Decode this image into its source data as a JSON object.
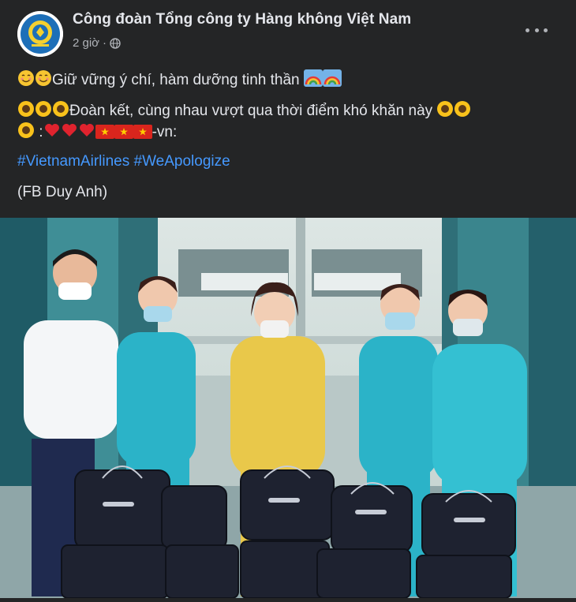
{
  "post": {
    "author": "Công đoàn Tổng công ty Hàng không Việt Nam",
    "time": "2 giờ",
    "privacy_icon": "globe-icon",
    "line1": "Giữ vững ý chí, hàm dưỡng tinh thần",
    "line2": "Đoàn kết, cùng nhau vượt qua thời điểm khó khăn này",
    "line3_suffix": "-vn:",
    "hashtag1": "#VietnamAirlines",
    "hashtag2": "#WeApologize",
    "credit": "(FB Duy Anh)"
  },
  "colors": {
    "background": "#242526",
    "text": "#e4e6eb",
    "muted": "#b0b3b8",
    "link": "#4599ff",
    "uniform_teal": "#2bb3c8",
    "uniform_yellow": "#e9c84a"
  }
}
